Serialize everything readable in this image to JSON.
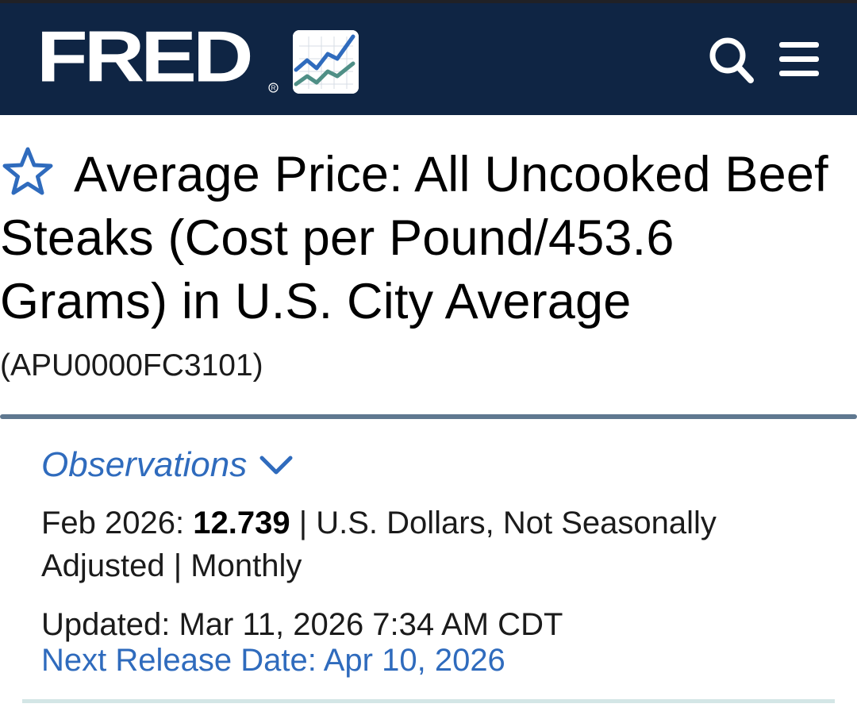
{
  "header": {
    "logo_text": "FRED",
    "brand_color": "#0f2544",
    "search_icon": "search-icon",
    "menu_icon": "hamburger-menu-icon"
  },
  "series": {
    "title": "Average Price: All Uncooked Beef Steaks (Cost per Pound/453.6 Grams) in U.S. City Average",
    "id": "(APU0000FC3101)",
    "favorite_icon": "star-outline-icon"
  },
  "observations": {
    "label": "Observations",
    "toggle_icon": "chevron-down-icon",
    "period": "Feb 2026:",
    "value": "12.739",
    "details_line1": "| U.S. Dollars, Not Seasonally",
    "details_line2": "Adjusted | Monthly",
    "updated": "Updated: Mar 11, 2026 7:34 AM CDT",
    "next_release": "Next Release Date: Apr 10, 2026",
    "link_color": "#2f6bbd"
  }
}
